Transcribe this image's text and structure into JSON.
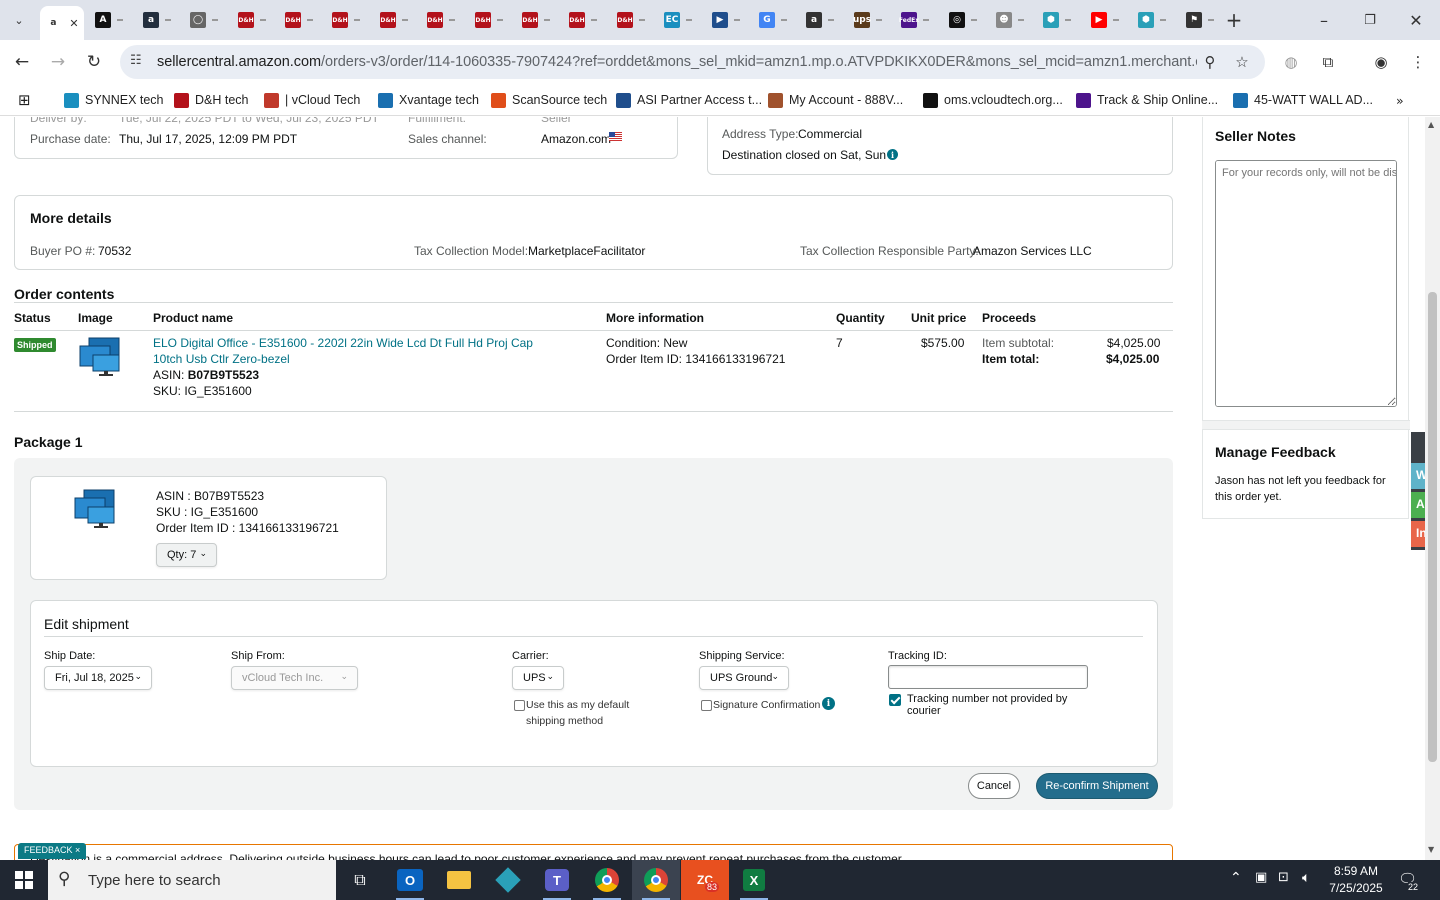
{
  "browser": {
    "tabs": [
      {
        "icon": "amazon-seller-icon",
        "color": "#ffffff",
        "active": true
      },
      {
        "icon": "a-circle-icon",
        "color": "#111111"
      },
      {
        "icon": "amazon-icon",
        "color": "#232f3e"
      },
      {
        "icon": "globe-icon",
        "color": "#666666"
      },
      {
        "icon": "dh-icon",
        "color": "#b3121b"
      },
      {
        "icon": "dh-icon",
        "color": "#b3121b"
      },
      {
        "icon": "dh-icon",
        "color": "#b3121b"
      },
      {
        "icon": "dh-icon",
        "color": "#b3121b"
      },
      {
        "icon": "dh-icon",
        "color": "#b3121b"
      },
      {
        "icon": "dh-icon",
        "color": "#b3121b"
      },
      {
        "icon": "dh-icon",
        "color": "#b3121b"
      },
      {
        "icon": "dh-icon",
        "color": "#b3121b"
      },
      {
        "icon": "dh-icon",
        "color": "#b3121b"
      },
      {
        "icon": "ec-icon",
        "color": "#1a8fbf"
      },
      {
        "icon": "asi-icon",
        "color": "#1f4e8c"
      },
      {
        "icon": "google-icon",
        "color": "#4285f4"
      },
      {
        "icon": "amazon-a-icon",
        "color": "#333333"
      },
      {
        "icon": "ups-icon",
        "color": "#5a3a1a"
      },
      {
        "icon": "fedex-icon",
        "color": "#4d148c"
      },
      {
        "icon": "openai-icon",
        "color": "#111111"
      },
      {
        "icon": "people-icon",
        "color": "#888888"
      },
      {
        "icon": "hex-icon",
        "color": "#2aa0b8"
      },
      {
        "icon": "youtube-icon",
        "color": "#ff0000"
      },
      {
        "icon": "hex-icon",
        "color": "#2aa0b8"
      },
      {
        "icon": "flag-icon",
        "color": "#333333"
      }
    ],
    "url_host": "sellercentral.amazon.com",
    "url_path": "/orders-v3/order/114-1060335-7907424?ref=orddet&mons_sel_mkid=amzn1.mp.o.ATVPDKIKX0DER&mons_sel_mcid=amzn1.merchant.o.AP...",
    "bookmarks": [
      {
        "label": "SYNNEX tech",
        "color": "#1a8fbf"
      },
      {
        "label": "D&H tech",
        "color": "#b3121b"
      },
      {
        "label": "| vCloud Tech",
        "color": "#c0392b"
      },
      {
        "label": "Xvantage tech",
        "color": "#1a6fb0"
      },
      {
        "label": "ScanSource tech",
        "color": "#e04e1a"
      },
      {
        "label": "ASI Partner Access t...",
        "color": "#1f4e8c"
      },
      {
        "label": "My Account - 888V...",
        "color": "#a0522d"
      },
      {
        "label": "oms.vcloudtech.org...",
        "color": "#111111"
      },
      {
        "label": "Track & Ship Online...",
        "color": "#4d148c"
      },
      {
        "label": "45-WATT WALL AD...",
        "color": "#1a6fb0"
      }
    ]
  },
  "order": {
    "partial_top_left": "Tue, Jul 22, 2025 PDT to Wed, Jul 23, 2025 PDT",
    "purchase_date_label": "Purchase date:",
    "purchase_date": "Thu, Jul 17, 2025, 12:09 PM PDT",
    "fulfillment_partial": "Fulfillment:",
    "fulfillment_value": "Seller",
    "sales_channel_label": "Sales channel:",
    "sales_channel": "Amazon.com",
    "address_type_label": "Address Type:",
    "address_type": "Commercial",
    "destination_closed": "Destination closed on Sat, Sun",
    "more_details_title": "More details",
    "buyer_po_label": "Buyer PO #:",
    "buyer_po": "70532",
    "tax_model_label": "Tax Collection Model:",
    "tax_model": "MarketplaceFacilitator",
    "tax_party_label": "Tax Collection Responsible Party:",
    "tax_party": "Amazon Services LLC"
  },
  "order_contents": {
    "title": "Order contents",
    "headers": [
      "Status",
      "Image",
      "Product name",
      "More information",
      "Quantity",
      "Unit price",
      "Proceeds"
    ],
    "row": {
      "status": "Shipped",
      "product_line1": "ELO Digital Office - E351600 - 2202l 22in Wide Lcd Dt Full Hd Proj Cap",
      "product_line2": "10tch Usb Ctlr Zero-bezel",
      "asin_label": "ASIN:",
      "asin": "B07B9T5523",
      "sku": "SKU: IG_E351600",
      "condition": "Condition: New",
      "order_item_id": "Order Item ID: 134166133196721",
      "quantity": "7",
      "unit_price": "$575.00",
      "subtotal_label": "Item subtotal:",
      "subtotal": "$4,025.00",
      "total_label": "Item total:",
      "total": "$4,025.00"
    }
  },
  "package": {
    "title": "Package 1",
    "asin": "ASIN : B07B9T5523",
    "sku": "SKU : IG_E351600",
    "order_item_id": "Order Item ID : 134166133196721",
    "qty": "Qty: 7"
  },
  "edit_shipment": {
    "title": "Edit shipment",
    "ship_date_label": "Ship Date:",
    "ship_date": "Fri, Jul 18, 2025",
    "ship_from_label": "Ship From:",
    "ship_from": "vCloud Tech Inc.",
    "carrier_label": "Carrier:",
    "carrier": "UPS",
    "default_line1": "Use this as my default",
    "default_line2": "shipping method",
    "service_label": "Shipping Service:",
    "service": "UPS Ground",
    "signature": "Signature Confirmation",
    "tracking_label": "Tracking ID:",
    "tracking_value": "",
    "tracking_not_provided_line1": "Tracking number not provided by",
    "tracking_not_provided_line2": "courier",
    "cancel": "Cancel",
    "reconfirm": "Re-confirm Shipment"
  },
  "warning": {
    "text": "Destination is a commercial address. Delivering outside business hours can lead to poor customer experience and may prevent repeat purchases from the customer.",
    "feedback_tag": "FEEDBACK ×"
  },
  "sidebar": {
    "seller_notes_title": "Seller Notes",
    "notes_placeholder": "For your records only, will not be displayed to the buyer.",
    "feedback_title": "Manage Feedback",
    "feedback_text_1": "Jason has not left you feedback for",
    "feedback_text_2": "this order yet.",
    "side_tabs": [
      {
        "label": "We",
        "color": "#5fb3c9"
      },
      {
        "label": "Ac",
        "color": "#4caf50"
      },
      {
        "label": "In",
        "color": "#e8664a"
      }
    ]
  },
  "taskbar": {
    "search_placeholder": "Type here to search",
    "time": "8:59 AM",
    "date": "7/25/2025",
    "notification_count": "22",
    "zoom_badge": "83"
  }
}
